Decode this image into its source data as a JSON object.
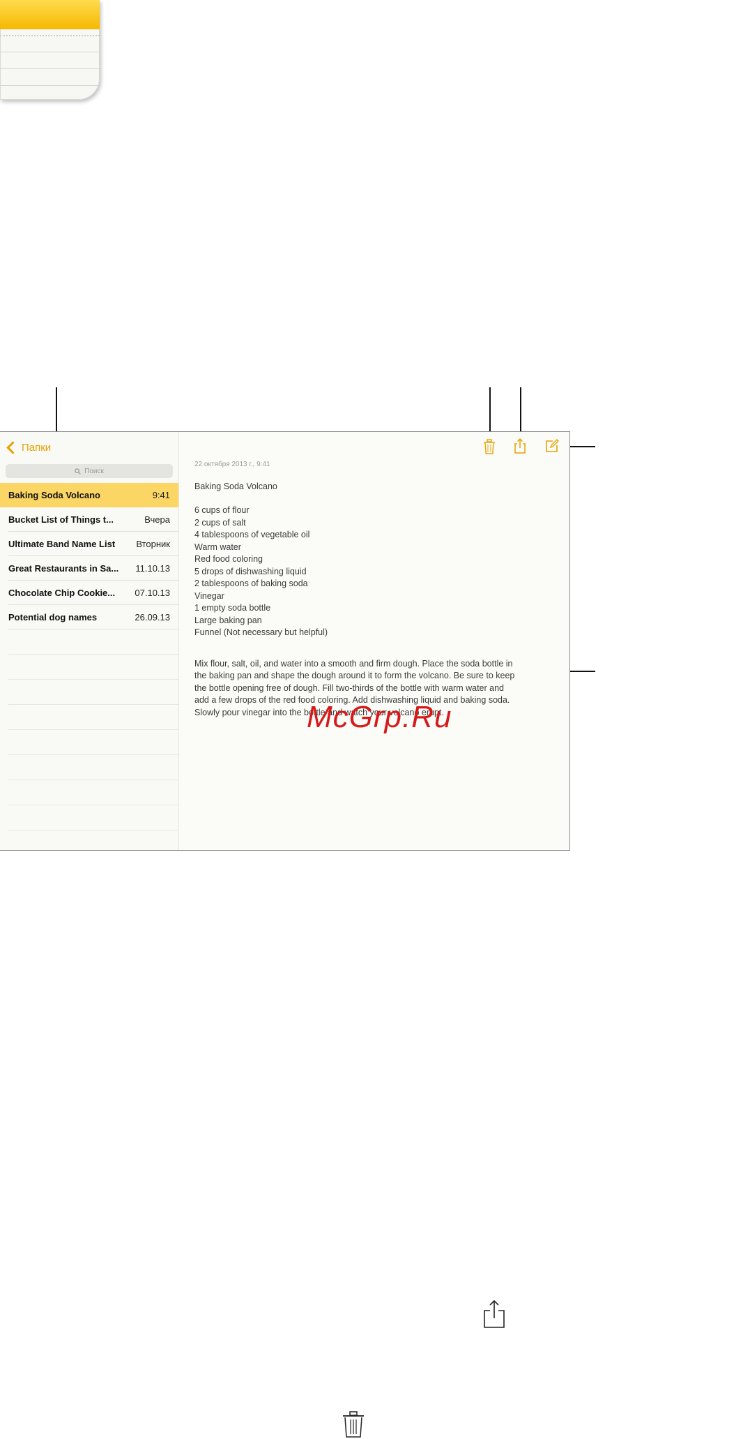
{
  "app": {
    "name": "Notes",
    "icon": "notes-app-icon"
  },
  "sidebar": {
    "back_label": "Папки",
    "search_placeholder": "Поиск",
    "notes": [
      {
        "title": "Baking Soda Volcano",
        "date": "9:41",
        "selected": true
      },
      {
        "title": "Bucket List of Things t...",
        "date": "Вчера"
      },
      {
        "title": "Ultimate Band Name List",
        "date": "Вторник"
      },
      {
        "title": "Great Restaurants in Sa...",
        "date": "11.10.13"
      },
      {
        "title": "Chocolate Chip Cookie...",
        "date": "07.10.13"
      },
      {
        "title": "Potential dog names",
        "date": "26.09.13"
      }
    ]
  },
  "toolbar": {
    "icons": [
      "trash-icon",
      "share-icon",
      "compose-icon"
    ],
    "accent_color": "#e8a200"
  },
  "note": {
    "date": "22 октября 2013 г., 9:41",
    "title": "Baking Soda Volcano",
    "ingredients": [
      "6 cups of flour",
      "2 cups of salt",
      "4 tablespoons of vegetable oil",
      "Warm water",
      "Red food coloring",
      "5 drops of dishwashing liquid",
      "2 tablespoons of baking soda",
      "Vinegar",
      "1 empty soda bottle",
      "Large baking pan",
      "Funnel (Not necessary but helpful)"
    ],
    "instructions": [
      "Mix flour, salt, oil, and water into a smooth and firm dough.  Place the soda bottle in",
      "the baking pan and shape the dough around it to form the volcano.  Be sure to keep",
      "the bottle opening free of dough.  Fill two-thirds of the bottle with warm water and",
      "add a few drops of the red food coloring. Add dishwashing liquid and baking soda.",
      "Slowly pour vinegar into the bottle and watch your volcano erupt."
    ]
  },
  "watermark": "McGrp.Ru",
  "colors": {
    "selected_row": "#fbd665",
    "accent": "#e8a200"
  }
}
